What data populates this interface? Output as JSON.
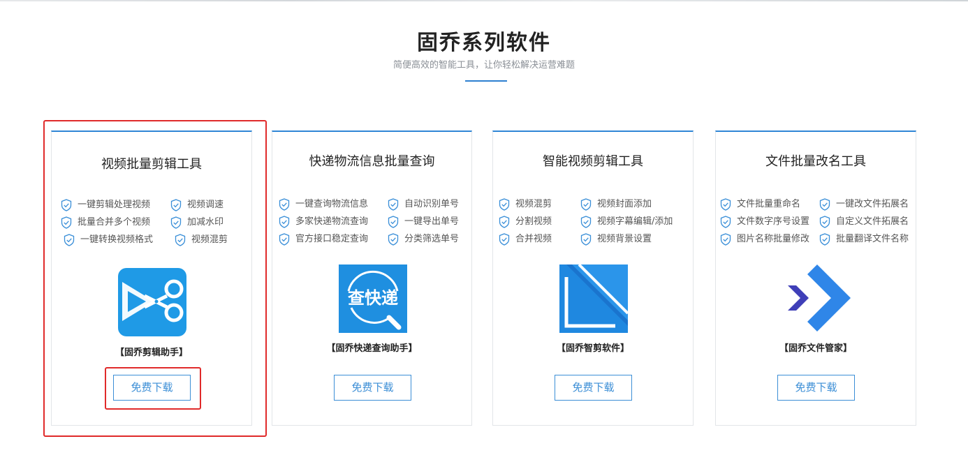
{
  "section": {
    "title": "固乔系列软件",
    "subtitle": "简便高效的智能工具，让你轻松解决运营难题"
  },
  "colors": {
    "accent": "#2f86d6",
    "highlight_border": "#e02a2a",
    "button_text": "#3b8ed6"
  },
  "cards": [
    {
      "title": "视频批量剪辑工具",
      "features": [
        "一键剪辑处理视频",
        "视频调速",
        "批量合并多个视频",
        "加减水印",
        "一键转换视频格式",
        "视频混剪"
      ],
      "logo_icon": "scissors-icon",
      "product_name": "【固乔剪辑助手】",
      "button": "免费下载",
      "highlighted": true
    },
    {
      "title": "快递物流信息批量查询",
      "features": [
        "一键查询物流信息",
        "自动识别单号",
        "多家快递物流查询",
        "一键导出单号",
        "官方接口稳定查询",
        "分类筛选单号"
      ],
      "logo_icon": "express-search-icon",
      "logo_text": "查快递",
      "product_name": "【固乔快递查询助手】",
      "button": "免费下载"
    },
    {
      "title": "智能视频剪辑工具",
      "features": [
        "视频混剪",
        "视频封面添加",
        "分割视频",
        "视频字幕编辑/添加",
        "合并视频",
        "视频背景设置"
      ],
      "logo_icon": "smart-cut-icon",
      "product_name": "【固乔智剪软件】",
      "button": "免费下载"
    },
    {
      "title": "文件批量改名工具",
      "features": [
        "文件批量重命名",
        "一键改文件拓展名",
        "文件数字序号设置",
        "自定义文件拓展名",
        "图片名称批量修改",
        "批量翻译文件名称"
      ],
      "logo_icon": "file-manager-icon",
      "product_name": "【固乔文件管家】",
      "button": "免费下载"
    }
  ]
}
